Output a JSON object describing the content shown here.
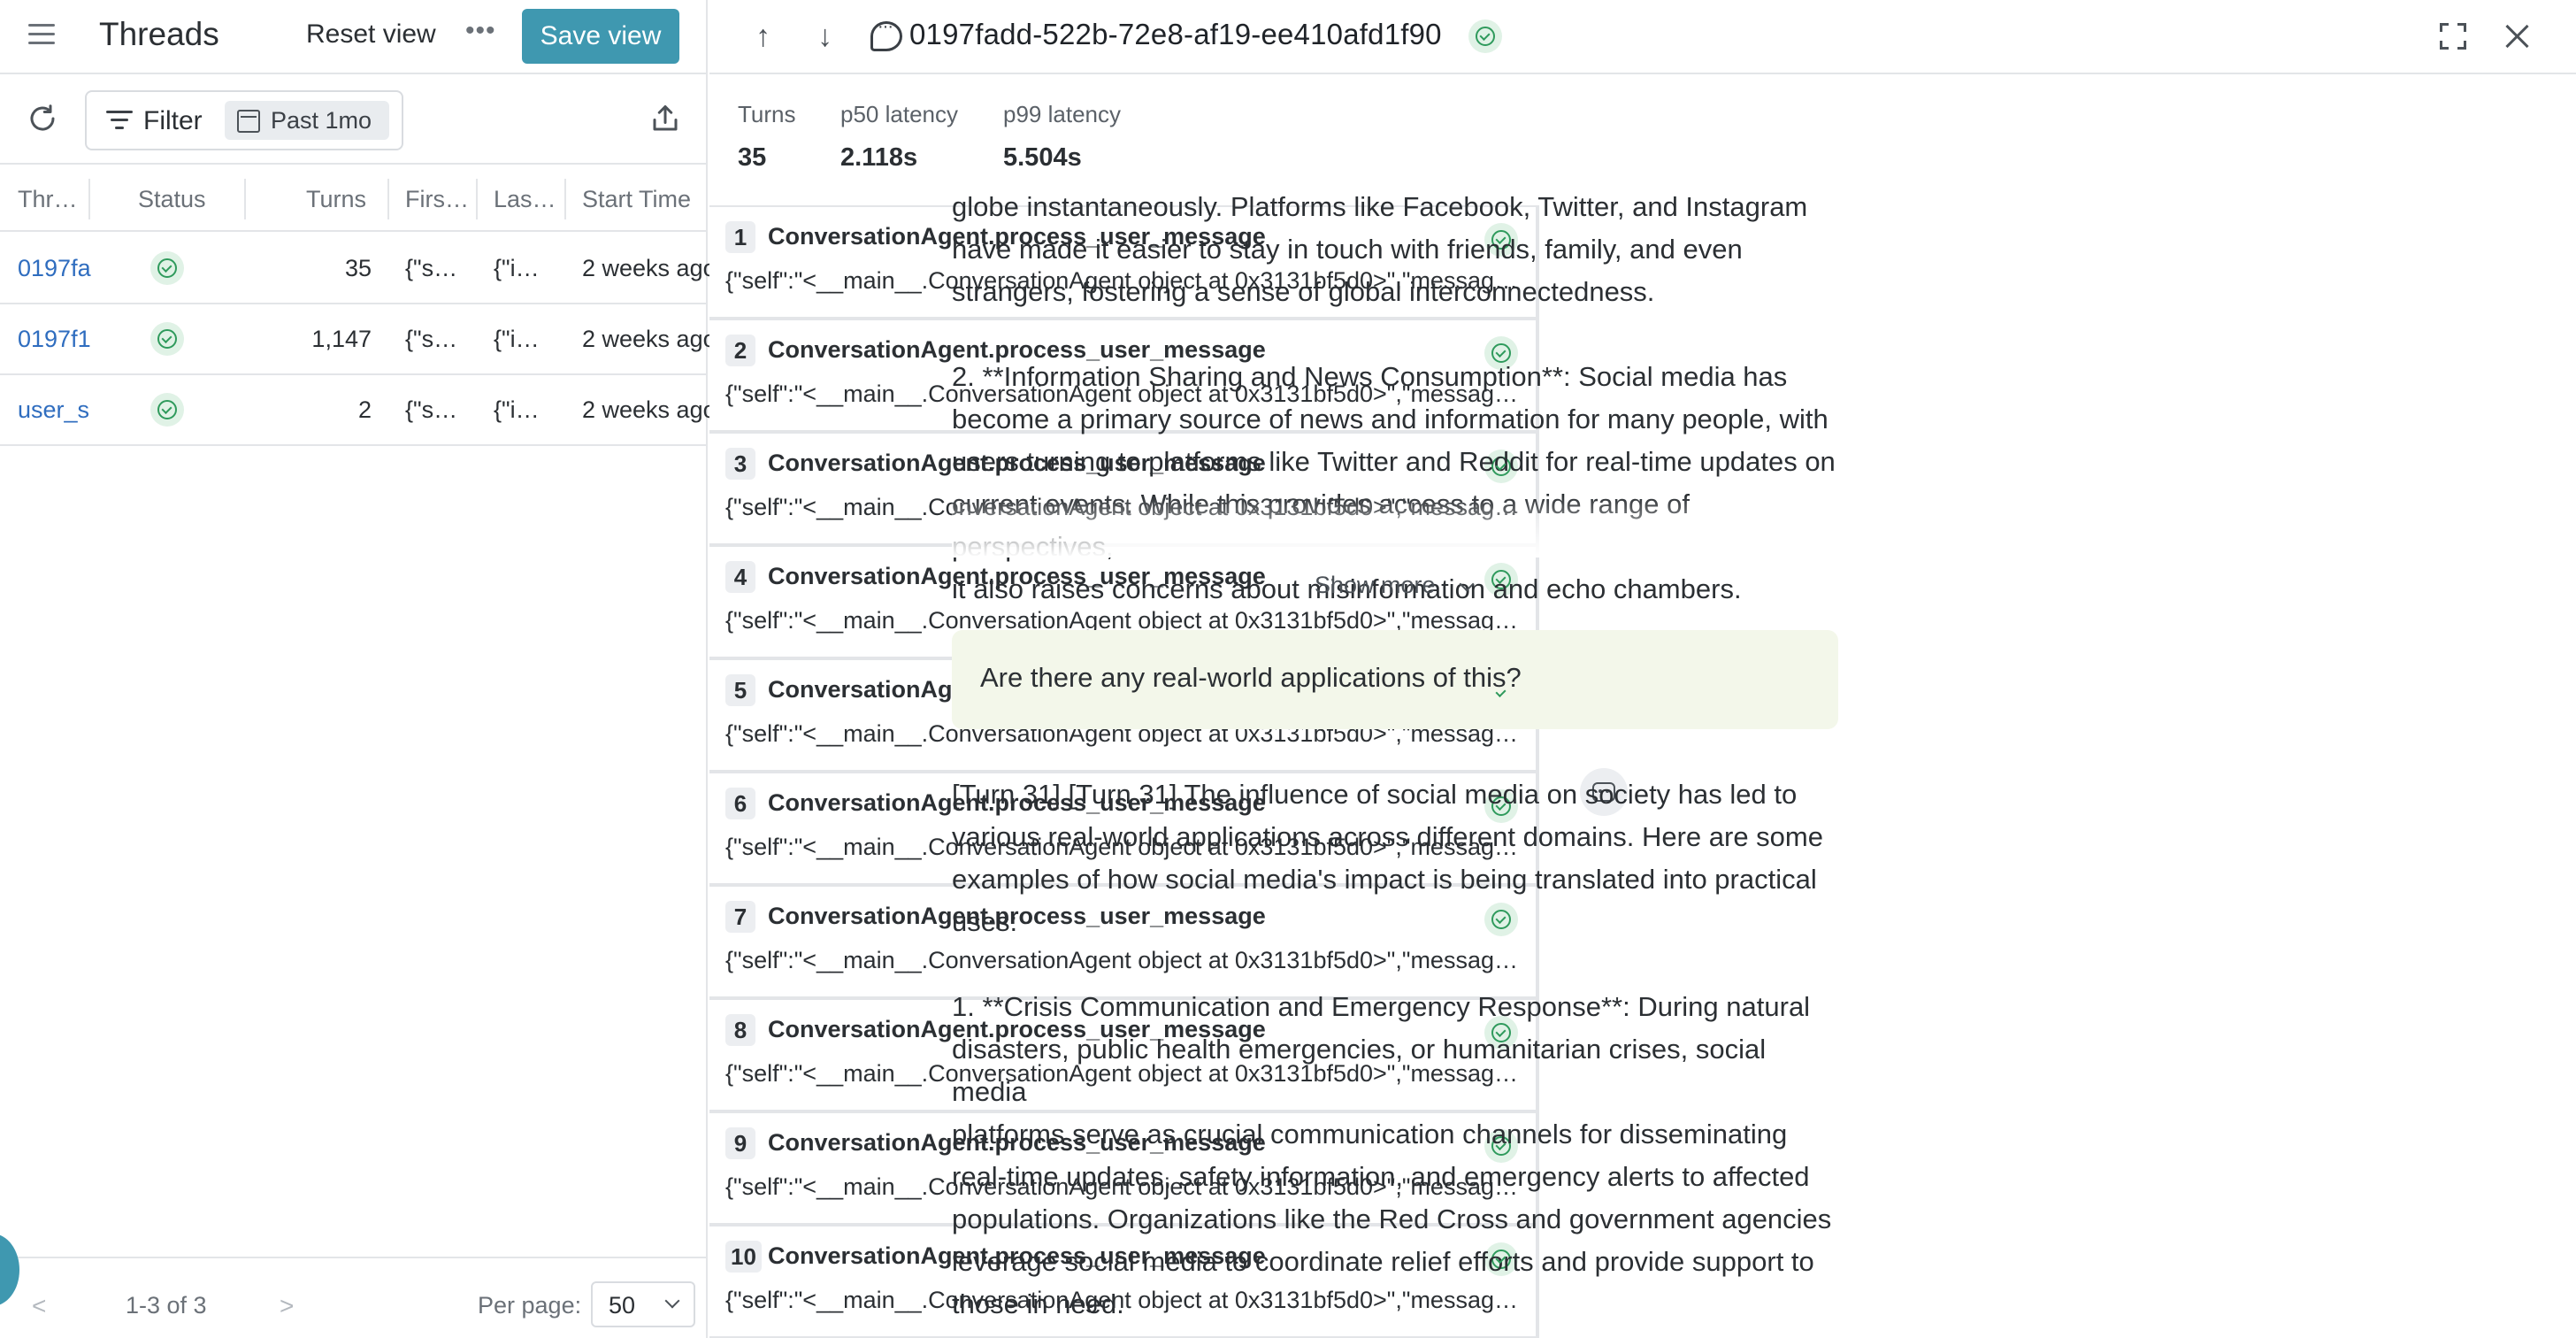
{
  "header": {
    "title": "Threads",
    "reset_view": "Reset view",
    "more": "•••",
    "save_view": "Save view"
  },
  "toolbar": {
    "filter_label": "Filter",
    "date_range": "Past 1mo"
  },
  "table": {
    "columns": [
      "Thr…",
      "Status",
      "Turns",
      "Firs…",
      "Las…",
      "Start Time"
    ],
    "rows": [
      {
        "thread": "0197fa",
        "status": "success",
        "turns": "35",
        "first": "{\"s…",
        "last": "{\"i…",
        "start": "2 weeks ago"
      },
      {
        "thread": "0197f1",
        "status": "success",
        "turns": "1,147",
        "first": "{\"s…",
        "last": "{\"i…",
        "start": "2 weeks ago"
      },
      {
        "thread": "user_s",
        "status": "success",
        "turns": "2",
        "first": "{\"s…",
        "last": "{\"i…",
        "start": "2 weeks ago"
      }
    ]
  },
  "pagination": {
    "prev": "<",
    "info": "1-3 of 3",
    "next": ">",
    "per_page_label": "Per page:",
    "per_page_value": "50"
  },
  "detail": {
    "up": "↑",
    "down": "↓",
    "thread_id": "0197fadd-522b-72e8-af19-ee410afd1f90",
    "stats": [
      {
        "label": "Turns",
        "value": "35"
      },
      {
        "label": "p50 latency",
        "value": "2.118s"
      },
      {
        "label": "p99 latency",
        "value": "5.504s"
      }
    ],
    "turns": [
      {
        "num": "1",
        "name": "ConversationAgent.process_user_message",
        "input": "{\"self\":\"<__main__.ConversationAgent object at 0x3131bf5d0>\",\"message…"
      },
      {
        "num": "2",
        "name": "ConversationAgent.process_user_message",
        "input": "{\"self\":\"<__main__.ConversationAgent object at 0x3131bf5d0>\",\"message…"
      },
      {
        "num": "3",
        "name": "ConversationAgent.process_user_message",
        "input": "{\"self\":\"<__main__.ConversationAgent object at 0x3131bf5d0>\",\"message…"
      },
      {
        "num": "4",
        "name": "ConversationAgent.process_user_message",
        "input": "{\"self\":\"<__main__.ConversationAgent object at 0x3131bf5d0>\",\"message…"
      },
      {
        "num": "5",
        "name": "ConversationAgent.process_user_message",
        "input": "{\"self\":\"<__main__.ConversationAgent object at 0x3131bf5d0>\",\"message…"
      },
      {
        "num": "6",
        "name": "ConversationAgent.process_user_message",
        "input": "{\"self\":\"<__main__.ConversationAgent object at 0x3131bf5d0>\",\"message…"
      },
      {
        "num": "7",
        "name": "ConversationAgent.process_user_message",
        "input": "{\"self\":\"<__main__.ConversationAgent object at 0x3131bf5d0>\",\"message…"
      },
      {
        "num": "8",
        "name": "ConversationAgent.process_user_message",
        "input": "{\"self\":\"<__main__.ConversationAgent object at 0x3131bf5d0>\",\"message…"
      },
      {
        "num": "9",
        "name": "ConversationAgent.process_user_message",
        "input": "{\"self\":\"<__main__.ConversationAgent object at 0x3131bf5d0>\",\"message…"
      },
      {
        "num": "10",
        "name": "ConversationAgent.process_user_message",
        "input": "{\"self\":\"<__main__.ConversationAgent object at 0x3131bf5d0>\",\"message…"
      }
    ]
  },
  "chat": {
    "prev_response": "globe instantaneously. Platforms like Facebook, Twitter, and Instagram\nhave made it easier to stay in touch with friends, family, and even\nstrangers, fostering a sense of global interconnectedness.\n\n2. **Information Sharing and News Consumption**: Social media has\nbecome a primary source of news and information for many people, with\nusers turning to platforms like Twitter and Reddit for real-time updates on\ncurrent events. While this provides access to a wide range of perspectives,\nit also raises concerns about misinformation and echo chambers.",
    "show_more": "Show more",
    "user_message": "Are there any real-world applications of this?",
    "bot_response": "[Turn 31] [Turn 31] The influence of social media on society has led to\nvarious real-world applications across different domains. Here are some\nexamples of how social media's impact is being translated into practical\nuses:\n\n1. **Crisis Communication and Emergency Response**: During natural\ndisasters, public health emergencies, or humanitarian crises, social media\nplatforms serve as crucial communication channels for disseminating\nreal-time updates, safety information, and emergency alerts to affected\npopulations. Organizations like the Red Cross and government agencies\nleverage social media to coordinate relief efforts and provide support to\nthose in need."
  },
  "colors": {
    "accent": "#3f98b0",
    "link": "#2f6dbf",
    "success": "#2f9a5c",
    "user_bubble": "#f3f7ea"
  }
}
